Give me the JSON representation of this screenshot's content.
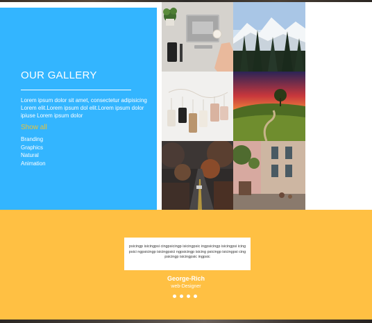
{
  "gallery": {
    "title": "OUR GALLERY",
    "description": "Lorem ipsum dolor sit amet, consectetur adipisicing Lorem elit.Lorem ipsum dol elit.Lorem ipsum dolor ipiuse Lorem ipsum dolor",
    "show_all": "Show all",
    "filters": [
      "Branding",
      "Graphics",
      "Natural",
      "Animation"
    ],
    "accent_color": "#33b5ff",
    "show_all_color": "#e8c23a"
  },
  "photos": [
    {
      "subject": "laptop-desk-photo"
    },
    {
      "subject": "snowy-mountains-photo"
    },
    {
      "subject": "hanging-tags-photo"
    },
    {
      "subject": "sunset-hill-photo"
    },
    {
      "subject": "autumn-road-photo"
    },
    {
      "subject": "street-houses-photo"
    }
  ],
  "testimonial": {
    "quote": "psicingp isicingpsi cingpsicingp isicingpsic ingpsicingp isicingpsi icingpsici ngpsicingp isicingpsici ngpsicingp isicing psicingp isicingpsi cingpsicingp isicingpsic ingpsic",
    "author": "George-Rich",
    "role": "web-Designer",
    "dots": 4,
    "band_color": "#ffc043"
  }
}
